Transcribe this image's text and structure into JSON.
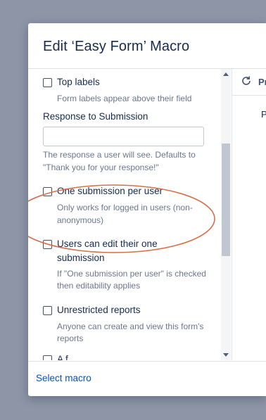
{
  "modal": {
    "title": "Edit ‘Easy Form’ Macro"
  },
  "params": {
    "top_labels": {
      "label": "Top labels",
      "description": "Form labels appear above their field",
      "checked": false
    },
    "response": {
      "label": "Response to Submission",
      "value": "",
      "description_line1": "The response a user will see. Defaults to",
      "description_line2": "\"Thank you for your response!\""
    },
    "one_submission": {
      "label": "One submission per user",
      "description_line1": "Only works for logged in users (non-",
      "description_line2": "anonymous)",
      "checked": false
    },
    "users_edit": {
      "label_line1": "Users can edit their one",
      "label_line2": "submission",
      "description_line1": "If \"One submission per user\" is checked",
      "description_line2": "then editability applies",
      "checked": false
    },
    "unrestricted": {
      "label": "Unrestricted reports",
      "description_line1": "Anyone can create and view this form's",
      "description_line2": "reports",
      "checked": false
    },
    "partial_next": {
      "label": "A        f",
      "checked": false
    }
  },
  "preview": {
    "toolbar_label": "Pr",
    "body_text": "P"
  },
  "footer": {
    "select_macro": "Select macro"
  },
  "icons": {
    "refresh": "refresh-icon"
  },
  "colors": {
    "annotation": "#d4704a",
    "link": "#0052cc"
  }
}
